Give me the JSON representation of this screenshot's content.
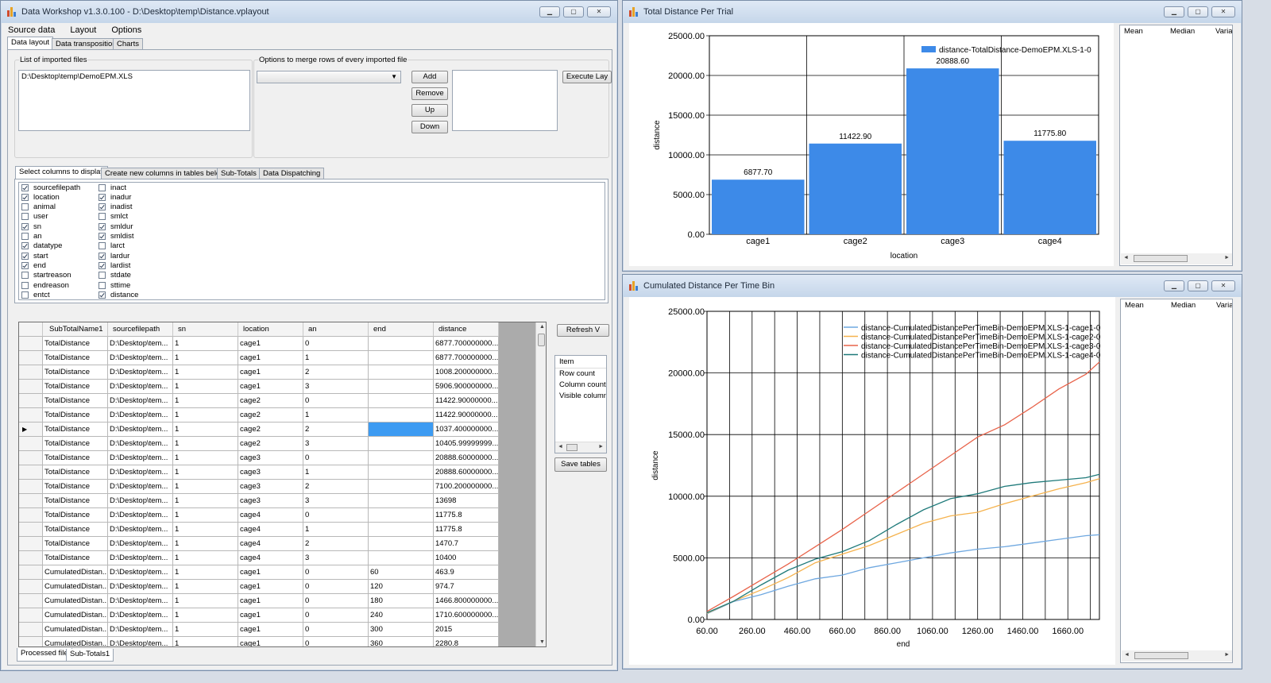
{
  "main_window": {
    "title": "Data Workshop v1.3.0.100 - D:\\Desktop\\temp\\Distance.vplayout",
    "menu": [
      "Source data",
      "Layout",
      "Options"
    ],
    "tabs": [
      "Data layout",
      "Data transposition",
      "Charts"
    ],
    "imported_files_label": "List of imported files",
    "imported_files": [
      "D:\\Desktop\\temp\\DemoEPM.XLS"
    ],
    "merge_label": "Options to merge rows of every imported file",
    "merge_select_value": "",
    "buttons": {
      "add": "Add",
      "remove": "Remove",
      "up": "Up",
      "down": "Down",
      "execute": "Execute Lay",
      "refresh": "Refresh V",
      "save_tables": "Save tables"
    },
    "sub_tabs": [
      "Select columns to display",
      "Create new columns in tables below",
      "Sub-Totals",
      "Data Dispatching"
    ],
    "columns_left": [
      {
        "name": "sourcefilepath",
        "checked": true
      },
      {
        "name": "location",
        "checked": true
      },
      {
        "name": "animal",
        "checked": false
      },
      {
        "name": "user",
        "checked": false
      },
      {
        "name": "sn",
        "checked": true
      },
      {
        "name": "an",
        "checked": false
      },
      {
        "name": "datatype",
        "checked": true
      },
      {
        "name": "start",
        "checked": true
      },
      {
        "name": "end",
        "checked": true
      },
      {
        "name": "startreason",
        "checked": false
      },
      {
        "name": "endreason",
        "checked": false
      },
      {
        "name": "entct",
        "checked": false
      }
    ],
    "columns_right": [
      {
        "name": "inact",
        "checked": false
      },
      {
        "name": "inadur",
        "checked": true
      },
      {
        "name": "inadist",
        "checked": true
      },
      {
        "name": "smlct",
        "checked": false
      },
      {
        "name": "smldur",
        "checked": true
      },
      {
        "name": "smldist",
        "checked": true
      },
      {
        "name": "larct",
        "checked": false
      },
      {
        "name": "lardur",
        "checked": true
      },
      {
        "name": "lardist",
        "checked": true
      },
      {
        "name": "stdate",
        "checked": false
      },
      {
        "name": "sttime",
        "checked": false
      },
      {
        "name": "distance",
        "checked": true
      }
    ],
    "grid_headers": [
      "SubTotalName1",
      "sourcefilepath",
      "sn",
      "location",
      "an",
      "end",
      "distance"
    ],
    "grid_rows": [
      [
        "TotalDistance",
        "D:\\Desktop\\tem...",
        "1",
        "cage1",
        "0",
        "",
        "6877.700000000..."
      ],
      [
        "TotalDistance",
        "D:\\Desktop\\tem...",
        "1",
        "cage1",
        "1",
        "",
        "6877.700000000..."
      ],
      [
        "TotalDistance",
        "D:\\Desktop\\tem...",
        "1",
        "cage1",
        "2",
        "",
        "1008.200000000..."
      ],
      [
        "TotalDistance",
        "D:\\Desktop\\tem...",
        "1",
        "cage1",
        "3",
        "",
        "5906.900000000..."
      ],
      [
        "TotalDistance",
        "D:\\Desktop\\tem...",
        "1",
        "cage2",
        "0",
        "",
        "11422.90000000..."
      ],
      [
        "TotalDistance",
        "D:\\Desktop\\tem...",
        "1",
        "cage2",
        "1",
        "",
        "11422.90000000..."
      ],
      [
        "TotalDistance",
        "D:\\Desktop\\tem...",
        "1",
        "cage2",
        "2",
        "",
        "1037.400000000..."
      ],
      [
        "TotalDistance",
        "D:\\Desktop\\tem...",
        "1",
        "cage2",
        "3",
        "",
        "10405.99999999..."
      ],
      [
        "TotalDistance",
        "D:\\Desktop\\tem...",
        "1",
        "cage3",
        "0",
        "",
        "20888.60000000..."
      ],
      [
        "TotalDistance",
        "D:\\Desktop\\tem...",
        "1",
        "cage3",
        "1",
        "",
        "20888.60000000..."
      ],
      [
        "TotalDistance",
        "D:\\Desktop\\tem...",
        "1",
        "cage3",
        "2",
        "",
        "7100.200000000..."
      ],
      [
        "TotalDistance",
        "D:\\Desktop\\tem...",
        "1",
        "cage3",
        "3",
        "",
        "13698"
      ],
      [
        "TotalDistance",
        "D:\\Desktop\\tem...",
        "1",
        "cage4",
        "0",
        "",
        "11775.8"
      ],
      [
        "TotalDistance",
        "D:\\Desktop\\tem...",
        "1",
        "cage4",
        "1",
        "",
        "11775.8"
      ],
      [
        "TotalDistance",
        "D:\\Desktop\\tem...",
        "1",
        "cage4",
        "2",
        "",
        "1470.7"
      ],
      [
        "TotalDistance",
        "D:\\Desktop\\tem...",
        "1",
        "cage4",
        "3",
        "",
        "10400"
      ],
      [
        "CumulatedDistan...",
        "D:\\Desktop\\tem...",
        "1",
        "cage1",
        "0",
        "60",
        "463.9"
      ],
      [
        "CumulatedDistan...",
        "D:\\Desktop\\tem...",
        "1",
        "cage1",
        "0",
        "120",
        "974.7"
      ],
      [
        "CumulatedDistan...",
        "D:\\Desktop\\tem...",
        "1",
        "cage1",
        "0",
        "180",
        "1466.800000000..."
      ],
      [
        "CumulatedDistan...",
        "D:\\Desktop\\tem...",
        "1",
        "cage1",
        "0",
        "240",
        "1710.600000000..."
      ],
      [
        "CumulatedDistan...",
        "D:\\Desktop\\tem...",
        "1",
        "cage1",
        "0",
        "300",
        "2015"
      ],
      [
        "CumulatedDistan...",
        "D:\\Desktop\\tem...",
        "1",
        "cage1",
        "0",
        "360",
        "2280.8"
      ]
    ],
    "selected_row": 6,
    "info_list_header": "Item",
    "info_list": [
      "Row count",
      "Column count",
      "Visible column"
    ],
    "bottom_tabs": [
      "Processed file",
      "Sub-Totals1"
    ]
  },
  "bar_window": {
    "title": "Total Distance Per Trial",
    "stats_headers": [
      "Mean",
      "Median",
      "Varia"
    ]
  },
  "line_window": {
    "title": "Cumulated Distance Per Time Bin",
    "stats_headers": [
      "Mean",
      "Median",
      "Varia"
    ]
  },
  "colors": {
    "bar": "#3d8ae8",
    "cage1": "#6fa8e0",
    "cage2": "#f5b24d",
    "cage3": "#e8634a",
    "cage4": "#1f7a7a",
    "selection": "#3d9bf2"
  },
  "chart_data": [
    {
      "type": "bar",
      "title": "",
      "xlabel": "location",
      "ylabel": "distance",
      "categories": [
        "cage1",
        "cage2",
        "cage3",
        "cage4"
      ],
      "series": [
        {
          "name": "distance-TotalDistance-DemoEPM.XLS-1-0",
          "values": [
            6877.7,
            11422.9,
            20888.6,
            11775.8
          ]
        }
      ],
      "data_labels": [
        "6877.70",
        "11422.90",
        "20888.60",
        "11775.80"
      ],
      "ylim": [
        0,
        25000
      ],
      "yticks": [
        "0.00",
        "5000.00",
        "10000.00",
        "15000.00",
        "20000.00",
        "25000.00"
      ],
      "grid": true,
      "legend": "top-right"
    },
    {
      "type": "line",
      "title": "",
      "xlabel": "end",
      "ylabel": "distance",
      "xlim": [
        60,
        1800
      ],
      "ylim": [
        0,
        25000
      ],
      "xticks": [
        "60.00",
        "260.00",
        "460.00",
        "660.00",
        "860.00",
        "1060.00",
        "1260.00",
        "1460.00",
        "1660.00"
      ],
      "yticks": [
        "0.00",
        "5000.00",
        "10000.00",
        "15000.00",
        "20000.00",
        "25000.00"
      ],
      "grid": true,
      "legend": "top-right",
      "x": [
        60,
        180,
        300,
        420,
        540,
        660,
        780,
        900,
        1020,
        1140,
        1260,
        1380,
        1500,
        1620,
        1740,
        1800
      ],
      "series": [
        {
          "name": "distance-CumulatedDistancePerTimeBin-DemoEPM.XLS-1-cage1-0",
          "values": [
            463.9,
            1466.8,
            2015,
            2700,
            3300,
            3600,
            4200,
            4600,
            5000,
            5400,
            5700,
            5900,
            6200,
            6500,
            6800,
            6877.7
          ]
        },
        {
          "name": "distance-CumulatedDistancePerTimeBin-DemoEPM.XLS-1-cage2-0",
          "values": [
            500,
            1500,
            2400,
            3400,
            4600,
            5300,
            6000,
            6900,
            7800,
            8400,
            8700,
            9400,
            10000,
            10600,
            11100,
            11422.9
          ]
        },
        {
          "name": "distance-CumulatedDistancePerTimeBin-DemoEPM.XLS-1-cage3-0",
          "values": [
            650,
            1900,
            3200,
            4500,
            5900,
            7300,
            8800,
            10300,
            11800,
            13300,
            14800,
            15800,
            17200,
            18700,
            19900,
            20888.6
          ]
        },
        {
          "name": "distance-CumulatedDistancePerTimeBin-DemoEPM.XLS-1-cage4-0",
          "values": [
            550,
            1500,
            2800,
            4000,
            4900,
            5500,
            6400,
            7700,
            8900,
            9800,
            10200,
            10800,
            11100,
            11300,
            11500,
            11775.8
          ]
        }
      ]
    }
  ]
}
